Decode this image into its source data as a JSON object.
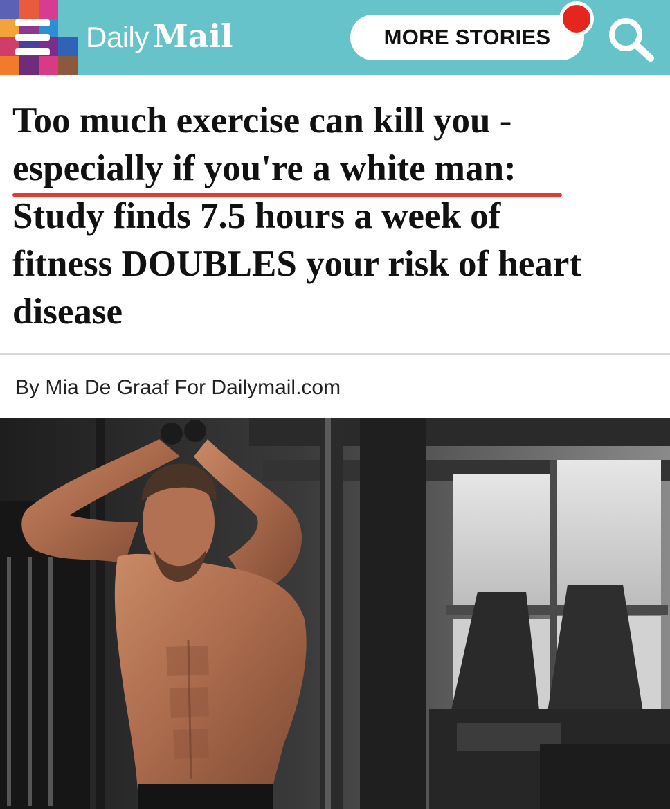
{
  "header": {
    "logo_daily": "Daily",
    "logo_mail": "Mail",
    "more_stories_label": "MORE STORIES",
    "colors": {
      "bar": "#67c3ca",
      "notification_dot": "#e5261f"
    },
    "icons": [
      "menu-icon",
      "search-icon",
      "notification-dot"
    ]
  },
  "article": {
    "headline_lines": [
      "Too much exercise can kill you -",
      "especially if you're a white man:",
      "Study finds 7.5 hours a week of",
      "fitness DOUBLES your risk of heart",
      "disease"
    ],
    "underline_color": "#e03a32",
    "byline": "By Mia De Graaf For Dailymail.com"
  }
}
